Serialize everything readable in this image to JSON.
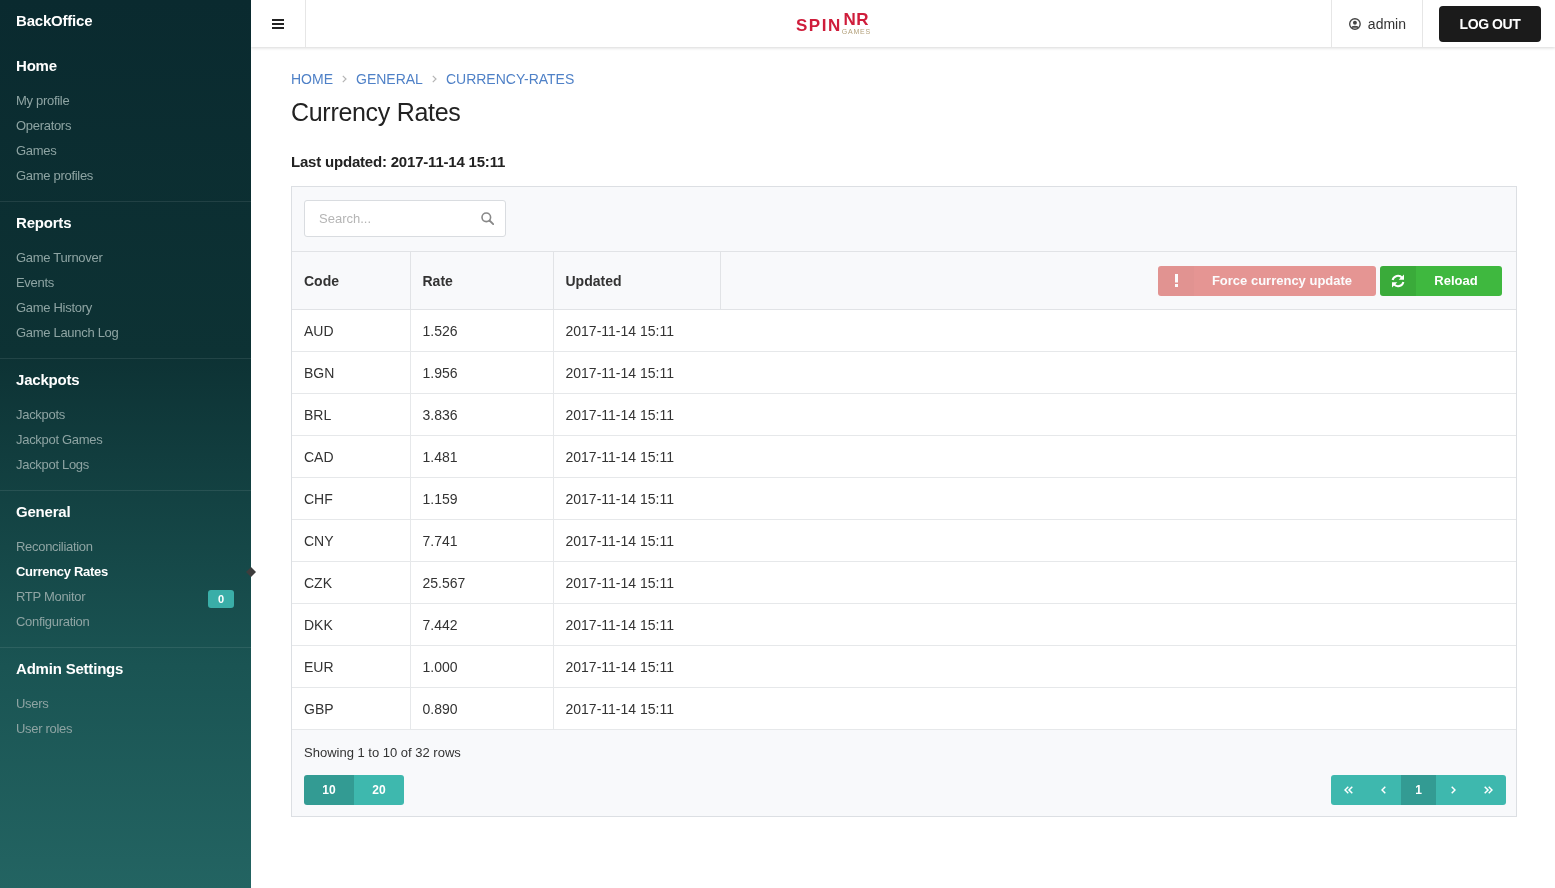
{
  "sidebar": {
    "brand": "BackOffice",
    "sections": [
      {
        "title": "Home",
        "items": [
          {
            "label": "My profile",
            "selected": false
          },
          {
            "label": "Operators",
            "selected": false
          },
          {
            "label": "Games",
            "selected": false
          },
          {
            "label": "Game profiles",
            "selected": false
          }
        ]
      },
      {
        "title": "Reports",
        "items": [
          {
            "label": "Game Turnover",
            "selected": false
          },
          {
            "label": "Events",
            "selected": false
          },
          {
            "label": "Game History",
            "selected": false
          },
          {
            "label": "Game Launch Log",
            "selected": false
          }
        ]
      },
      {
        "title": "Jackpots",
        "items": [
          {
            "label": "Jackpots",
            "selected": false
          },
          {
            "label": "Jackpot Games",
            "selected": false
          },
          {
            "label": "Jackpot Logs",
            "selected": false
          }
        ]
      },
      {
        "title": "General",
        "items": [
          {
            "label": "Reconciliation",
            "selected": false
          },
          {
            "label": "Currency Rates",
            "selected": true
          },
          {
            "label": "RTP Monitor",
            "selected": false,
            "badge": "0"
          },
          {
            "label": "Configuration",
            "selected": false
          }
        ]
      },
      {
        "title": "Admin Settings",
        "items": [
          {
            "label": "Users",
            "selected": false
          },
          {
            "label": "User roles",
            "selected": false
          }
        ]
      }
    ]
  },
  "top_bar": {
    "logo": {
      "text": "SPIN",
      "superscript": "NR",
      "tagline": "GAMES"
    },
    "user": "admin",
    "logout": "LOG OUT"
  },
  "breadcrumb": [
    "HOME",
    "GENERAL",
    "CURRENCY-RATES"
  ],
  "title": "Currency Rates",
  "last_updated": "Last updated: 2017-11-14 15:11",
  "table": {
    "search": {
      "placeholder": "Search..."
    },
    "columns": [
      "Code",
      "Rate",
      "Updated"
    ],
    "buttons": [
      {
        "kind": "force-update",
        "label": "Force currency update",
        "disabled": true
      },
      {
        "kind": "reload",
        "label": "Reload",
        "disabled": false
      }
    ],
    "rows": [
      [
        "AUD",
        "1.526",
        "2017-11-14 15:11"
      ],
      [
        "BGN",
        "1.956",
        "2017-11-14 15:11"
      ],
      [
        "BRL",
        "3.836",
        "2017-11-14 15:11"
      ],
      [
        "CAD",
        "1.481",
        "2017-11-14 15:11"
      ],
      [
        "CHF",
        "1.159",
        "2017-11-14 15:11"
      ],
      [
        "CNY",
        "7.741",
        "2017-11-14 15:11"
      ],
      [
        "CZK",
        "25.567",
        "2017-11-14 15:11"
      ],
      [
        "DKK",
        "7.442",
        "2017-11-14 15:11"
      ],
      [
        "EUR",
        "1.000",
        "2017-11-14 15:11"
      ],
      [
        "GBP",
        "0.890",
        "2017-11-14 15:11"
      ]
    ],
    "summary": "Showing 1 to 10 of 32 rows",
    "page_sizes": [
      {
        "label": "10",
        "selected": true
      },
      {
        "label": "20",
        "selected": false
      }
    ],
    "pages": [
      {
        "kind": "first",
        "selected": false
      },
      {
        "kind": "prev",
        "selected": false
      },
      {
        "kind": "page",
        "label": "1",
        "selected": true
      },
      {
        "kind": "next",
        "selected": false
      },
      {
        "kind": "last",
        "selected": false
      }
    ]
  }
}
